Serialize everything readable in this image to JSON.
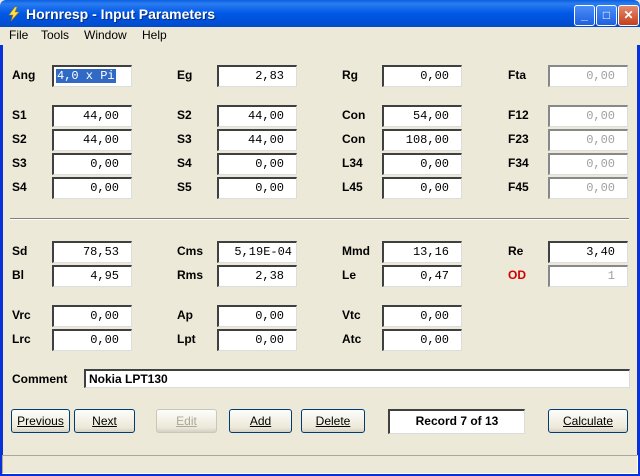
{
  "window": {
    "title": "Hornresp - Input Parameters",
    "minimize_glyph": "_",
    "maximize_glyph": "□",
    "close_glyph": "✕"
  },
  "menu": [
    "File",
    "Tools",
    "Window",
    "Help"
  ],
  "colors": {
    "titlebar": "#0054e3",
    "od_label": "#d00000",
    "selection": "#316ac5"
  },
  "labels": {
    "ang": "Ang",
    "eg": "Eg",
    "rg": "Rg",
    "fta": "Fta",
    "s1": "S1",
    "s2a": "S2",
    "con1": "Con",
    "f12": "F12",
    "s2b": "S2",
    "s3a": "S3",
    "con2": "Con",
    "f23": "F23",
    "s3b": "S3",
    "s4a": "S4",
    "l34": "L34",
    "f34": "F34",
    "s4b": "S4",
    "s5": "S5",
    "l45": "L45",
    "f45": "F45",
    "sd": "Sd",
    "cms": "Cms",
    "mmd": "Mmd",
    "re": "Re",
    "bl": "Bl",
    "rms": "Rms",
    "le": "Le",
    "od": "OD",
    "vrc": "Vrc",
    "ap": "Ap",
    "vtc": "Vtc",
    "lrc": "Lrc",
    "lpt": "Lpt",
    "atc": "Atc",
    "comment": "Comment"
  },
  "values": {
    "ang": "4,0 x Pi",
    "eg": "2,83",
    "rg": "0,00",
    "fta": "0,00",
    "s1": "44,00",
    "s2a": "44,00",
    "con1": "54,00",
    "f12": "0,00",
    "s2b": "44,00",
    "s3a": "44,00",
    "con2": "108,00",
    "f23": "0,00",
    "s3b": "0,00",
    "s4a": "0,00",
    "l34": "0,00",
    "f34": "0,00",
    "s4b": "0,00",
    "s5": "0,00",
    "l45": "0,00",
    "f45": "0,00",
    "sd": "78,53",
    "cms": "5,19E-04",
    "mmd": "13,16",
    "re": "3,40",
    "bl": "4,95",
    "rms": "2,38",
    "le": "0,47",
    "od": "1",
    "vrc": "0,00",
    "ap": "0,00",
    "vtc": "0,00",
    "lrc": "0,00",
    "lpt": "0,00",
    "atc": "0,00",
    "comment": "Nokia LPT130"
  },
  "buttons": {
    "previous": "Previous",
    "next": "Next",
    "edit": "Edit",
    "add": "Add",
    "delete": "Delete",
    "calculate": "Calculate"
  },
  "record_status": "Record 7 of 13"
}
